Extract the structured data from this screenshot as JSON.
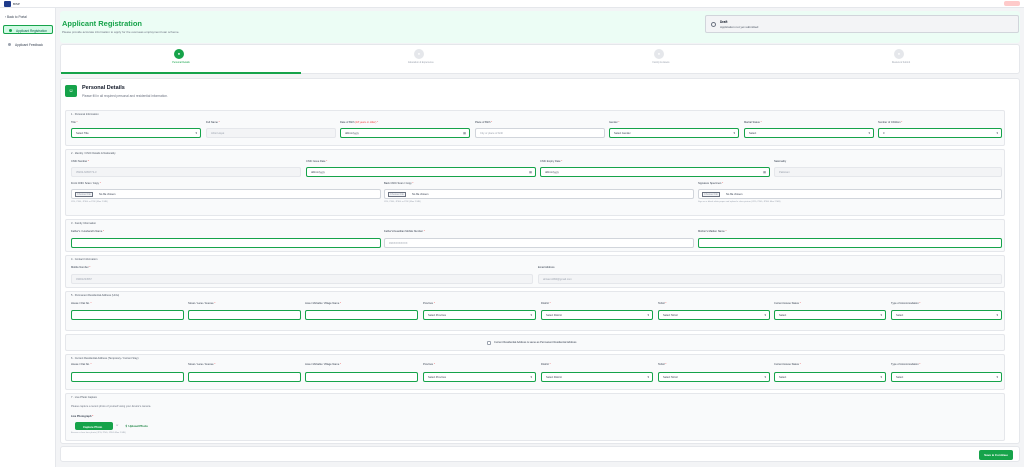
{
  "topbar": {
    "app": "BISP"
  },
  "sidebar": {
    "back": "‹ Back to Portal",
    "items": [
      {
        "label": "Applicant Registration",
        "active": true
      },
      {
        "label": "Applicant Feedback",
        "active": false
      }
    ]
  },
  "header": {
    "title": "Applicant Registration",
    "subtitle": "Please provide accurate information to apply for the overseas employment loan scheme.",
    "status_title": "Draft",
    "status_sub": "Application not yet submitted"
  },
  "steps": [
    "Personal Details",
    "Education & Experience",
    "Family & Assets",
    "Review & Submit"
  ],
  "card": {
    "title": "Personal Details",
    "subtitle": "Please fill in all required personal and residential information."
  },
  "s1": {
    "title": "1 · Personal Information",
    "title_l": "Title",
    "title_v": "Select Title",
    "fullname_l": "Full Name",
    "fullname_v": "Ahtsi Hayat",
    "dob_l": "Date of Birth",
    "dob_note": "(18 years or older)",
    "dob_v": "dd/mm/yyyy",
    "pob_l": "Place of Birth",
    "pob_v": "City or place of birth",
    "gender_l": "Gender",
    "gender_v": "Select Gender",
    "marital_l": "Marital Status",
    "marital_v": "Select",
    "children_l": "Number of Children",
    "children_v": "0"
  },
  "s2": {
    "title": "2 · Identity / CNIC Details & Nationality",
    "cnic_l": "CNIC Number",
    "cnic_v": "35202-6283772-3",
    "issue_l": "CNIC Issue Date",
    "issue_v": "dd/mm/yyyy",
    "expiry_l": "CNIC Expiry Date",
    "expiry_v": "dd/mm/yyyy",
    "nat_l": "Nationality",
    "nat_v": "Pakistani",
    "front_l": "Front CNIC Scan / Copy",
    "back_l": "Back CNIC Scan / Copy",
    "sig_l": "Signature Specimen",
    "choose": "Choose File",
    "nofile": "No file chosen",
    "hint": "JPG, PNG, JPEG or PDF (Max 2 MB)",
    "sig_hint": "Sign on a blank white paper and upload a clear picture (JPG, PNG, JPEG Max 2 MB)"
  },
  "s3": {
    "title": "3 · Family Information",
    "father_l": "Father's / Husband's Name",
    "fmob_l": "Father's/Guardian Mobile Number",
    "fmob_v": "03XXXXXXXXX",
    "mother_l": "Mother's Maiden Name"
  },
  "s4": {
    "title": "4 · Contact Information",
    "mobile_l": "Mobile Number",
    "mobile_v": "03001234567",
    "email_l": "Email Address",
    "email_v": "ahtsam1993@gmail.com"
  },
  "s5": {
    "title": "5 · Permanent Residential Address (Urdu)",
    "house_l": "House / Flat No.",
    "street_l": "Street / Lane / Avenue",
    "area_l": "Area / Mohalla / Village Name",
    "prov_l": "Province",
    "prov_v": "Select Province",
    "dist_l": "District",
    "dist_v": "Select District",
    "tehsil_l": "Tehsil",
    "tehsil_v": "Select Tehsil",
    "status_l": "Current House Status",
    "status_v": "Select",
    "accom_l": "Type of Accommodation",
    "accom_v": "Select"
  },
  "same": "Current Residential Address is same as Permanent Residential Address",
  "s6": {
    "title": "6 · Current Residential Address (Temporary / Current Stay)"
  },
  "s7": {
    "title": "7 · Live Photo Capture",
    "desc": "Please capture a recent photo of yourself using your device's camera.",
    "live_l": "Live Photograph",
    "capture": "Capture Photo",
    "or": "or",
    "upload": "Upload Photo",
    "hint": "Ensure a clear face photo (JPG, PNG, JPEG Max 2 MB)"
  },
  "footer": {
    "save": "Save & Continue"
  },
  "colors": {
    "accent": "#16a34a",
    "header_bg": "#ecfdf5"
  }
}
